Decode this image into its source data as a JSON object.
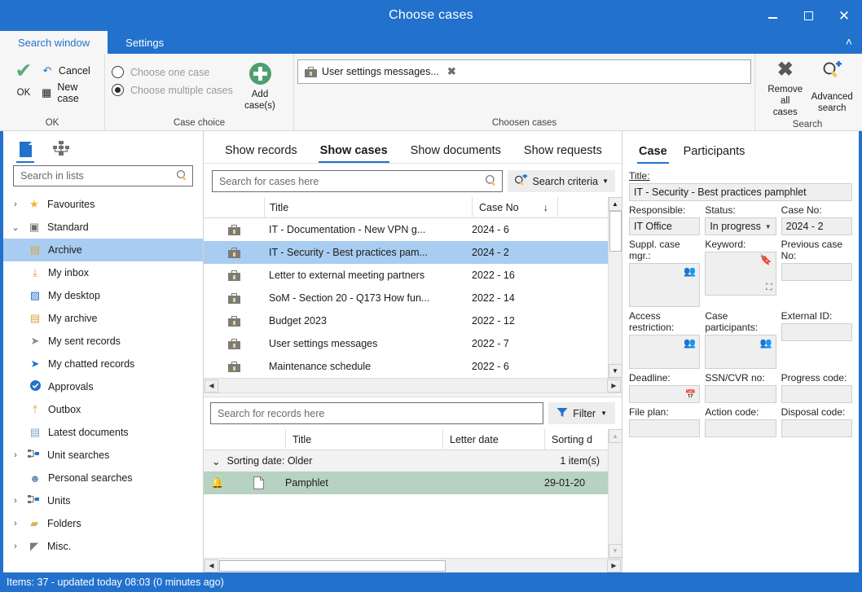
{
  "window": {
    "title": "Choose cases",
    "minimize_label": "Minimize",
    "maximize_label": "Maximize",
    "close_label": "Close",
    "accent_color": "#2271cd"
  },
  "ribbon": {
    "tabs": [
      {
        "label": "Search window",
        "active": true
      },
      {
        "label": "Settings",
        "active": false
      }
    ],
    "collapse_glyph": "˄",
    "groups": {
      "ok": {
        "label": "OK",
        "ok_button": "OK",
        "cancel_button": "Cancel",
        "new_case_button": "New case"
      },
      "case_choice": {
        "label": "Case choice",
        "options": [
          {
            "label": "Choose one case",
            "selected": false
          },
          {
            "label": "Choose multiple cases",
            "selected": true
          }
        ],
        "add_cases_button": "Add\ncase(s)",
        "add_cases_line1": "Add",
        "add_cases_line2": "case(s)"
      },
      "chosen_cases": {
        "label": "Choosen cases",
        "chips": [
          {
            "label": "User settings messages...",
            "remove_glyph": "✖"
          }
        ]
      },
      "search": {
        "label": "Search",
        "remove_all_line1": "Remove all",
        "remove_all_line2": "cases",
        "advanced_line1": "Advanced",
        "advanced_line2": "search"
      }
    }
  },
  "sidebar": {
    "view_icons": [
      {
        "name": "documents-view",
        "active": true
      },
      {
        "name": "org-view",
        "active": false
      }
    ],
    "search": {
      "placeholder": "Search in lists",
      "value": ""
    },
    "items": [
      {
        "label": "Favourites",
        "level": 1,
        "chevron": "›",
        "icon": "★",
        "icon_color": "#f0b429",
        "selected": false
      },
      {
        "label": "Standard",
        "level": 1,
        "chevron": "⌄",
        "icon": "▣",
        "icon_color": "#6d6d6d",
        "selected": false
      },
      {
        "label": "Archive",
        "level": 2,
        "chevron": "",
        "icon": "▤",
        "icon_color": "#d9a441",
        "selected": true
      },
      {
        "label": "My inbox",
        "level": 2,
        "chevron": "",
        "icon": "⤓",
        "icon_color": "#d9a441",
        "selected": false
      },
      {
        "label": "My desktop",
        "level": 2,
        "chevron": "",
        "icon": "▨",
        "icon_color": "#2271cd",
        "selected": false
      },
      {
        "label": "My archive",
        "level": 2,
        "chevron": "",
        "icon": "▤",
        "icon_color": "#d9a441",
        "selected": false
      },
      {
        "label": "My sent records",
        "level": 2,
        "chevron": "",
        "icon": "➤",
        "icon_color": "#8a8a8a",
        "selected": false
      },
      {
        "label": "My chatted records",
        "level": 2,
        "chevron": "",
        "icon": "➤",
        "icon_color": "#2271cd",
        "selected": false
      },
      {
        "label": "Approvals",
        "level": 2,
        "chevron": "",
        "icon": "✔",
        "icon_color": "#2271cd",
        "selected": false
      },
      {
        "label": "Outbox",
        "level": 2,
        "chevron": "",
        "icon": "⤒",
        "icon_color": "#d9a441",
        "selected": false
      },
      {
        "label": "Latest documents",
        "level": 2,
        "chevron": "",
        "icon": "▤",
        "icon_color": "#7c9ec4",
        "selected": false
      },
      {
        "label": "Unit searches",
        "level": 1,
        "chevron": "›",
        "icon": "⚬",
        "icon_color": "#2271cd",
        "selected": false
      },
      {
        "label": "Personal searches",
        "level": 2,
        "chevron": "",
        "icon": "☻",
        "icon_color": "#6a8fb5",
        "selected": false
      },
      {
        "label": "Units",
        "level": 1,
        "chevron": "›",
        "icon": "⚬",
        "icon_color": "#2271cd",
        "selected": false
      },
      {
        "label": "Folders",
        "level": 1,
        "chevron": "›",
        "icon": "▰",
        "icon_color": "#e0b057",
        "selected": false
      },
      {
        "label": "Misc.",
        "level": 1,
        "chevron": "›",
        "icon": "◤",
        "icon_color": "#7a7a7a",
        "selected": false
      }
    ]
  },
  "center": {
    "tabs": [
      {
        "label": "Show records",
        "active": false
      },
      {
        "label": "Show cases",
        "active": true
      },
      {
        "label": "Show documents",
        "active": false
      },
      {
        "label": "Show requests",
        "active": false
      }
    ],
    "case_search": {
      "placeholder": "Search for cases here",
      "value": ""
    },
    "search_criteria_button": "Search criteria",
    "cases_grid": {
      "columns": [
        {
          "label": "",
          "key": "icon"
        },
        {
          "label": "Title",
          "key": "title"
        },
        {
          "label": "Case No",
          "key": "case_no",
          "sort": "desc",
          "sort_glyph": "↓"
        },
        {
          "label": "",
          "key": "pad"
        }
      ],
      "rows": [
        {
          "title": "IT - Documentation - New VPN g...",
          "case_no": "2024 - 6",
          "selected": false
        },
        {
          "title": "IT - Security - Best practices pam...",
          "case_no": "2024 - 2",
          "selected": true
        },
        {
          "title": "Letter to external meeting partners",
          "case_no": "2022 - 16",
          "selected": false
        },
        {
          "title": "SoM - Section 20 - Q173 How fun...",
          "case_no": "2022 - 14",
          "selected": false
        },
        {
          "title": "Budget 2023",
          "case_no": "2022 - 12",
          "selected": false
        },
        {
          "title": "User settings messages",
          "case_no": "2022 - 7",
          "selected": false
        },
        {
          "title": "Maintenance schedule",
          "case_no": "2022 - 6",
          "selected": false
        }
      ]
    },
    "record_search": {
      "placeholder": "Search for records here",
      "value": ""
    },
    "filter_button": "Filter",
    "records_grid": {
      "columns": [
        {
          "label": "",
          "key": "flag"
        },
        {
          "label": "Title",
          "key": "title"
        },
        {
          "label": "Letter date",
          "key": "letter_date"
        },
        {
          "label": "Sorting d",
          "key": "sorting_date"
        }
      ],
      "group": {
        "label": "Sorting date:  Older",
        "count": "1 item(s)",
        "chevron": "⌄"
      },
      "rows": [
        {
          "title": "Pamphlet",
          "letter_date": "",
          "sorting_date": "29-01-20",
          "selected": true
        }
      ]
    }
  },
  "detail": {
    "tabs": [
      {
        "label": "Case",
        "active": true
      },
      {
        "label": "Participants",
        "active": false
      }
    ],
    "fields": {
      "title": {
        "label": "Title:",
        "value": "IT - Security - Best practices pamphlet"
      },
      "responsible": {
        "label": "Responsible:",
        "value": "IT Office"
      },
      "status": {
        "label": "Status:",
        "value": "In progress"
      },
      "case_no": {
        "label": "Case No:",
        "value": "2024 - 2"
      },
      "suppl_case_mgr": {
        "label": "Suppl. case mgr.:",
        "value": ""
      },
      "keyword": {
        "label": "Keyword:",
        "value": ""
      },
      "previous_case_no": {
        "label": "Previous case No:",
        "value": ""
      },
      "access_restriction": {
        "label": "Access restriction:",
        "value": ""
      },
      "case_participants": {
        "label": "Case participants:",
        "value": ""
      },
      "external_id": {
        "label": "External ID:",
        "value": ""
      },
      "deadline": {
        "label": "Deadline:",
        "value": ""
      },
      "ssn_cvr_no": {
        "label": "SSN/CVR no:",
        "value": ""
      },
      "progress_code": {
        "label": "Progress code:",
        "value": ""
      },
      "file_plan": {
        "label": "File plan:",
        "value": ""
      },
      "action_code": {
        "label": "Action code:",
        "value": ""
      },
      "disposal_code": {
        "label": "Disposal code:",
        "value": ""
      }
    }
  },
  "statusbar": {
    "text": "Items: 37 - updated today 08:03 (0 minutes ago)"
  }
}
